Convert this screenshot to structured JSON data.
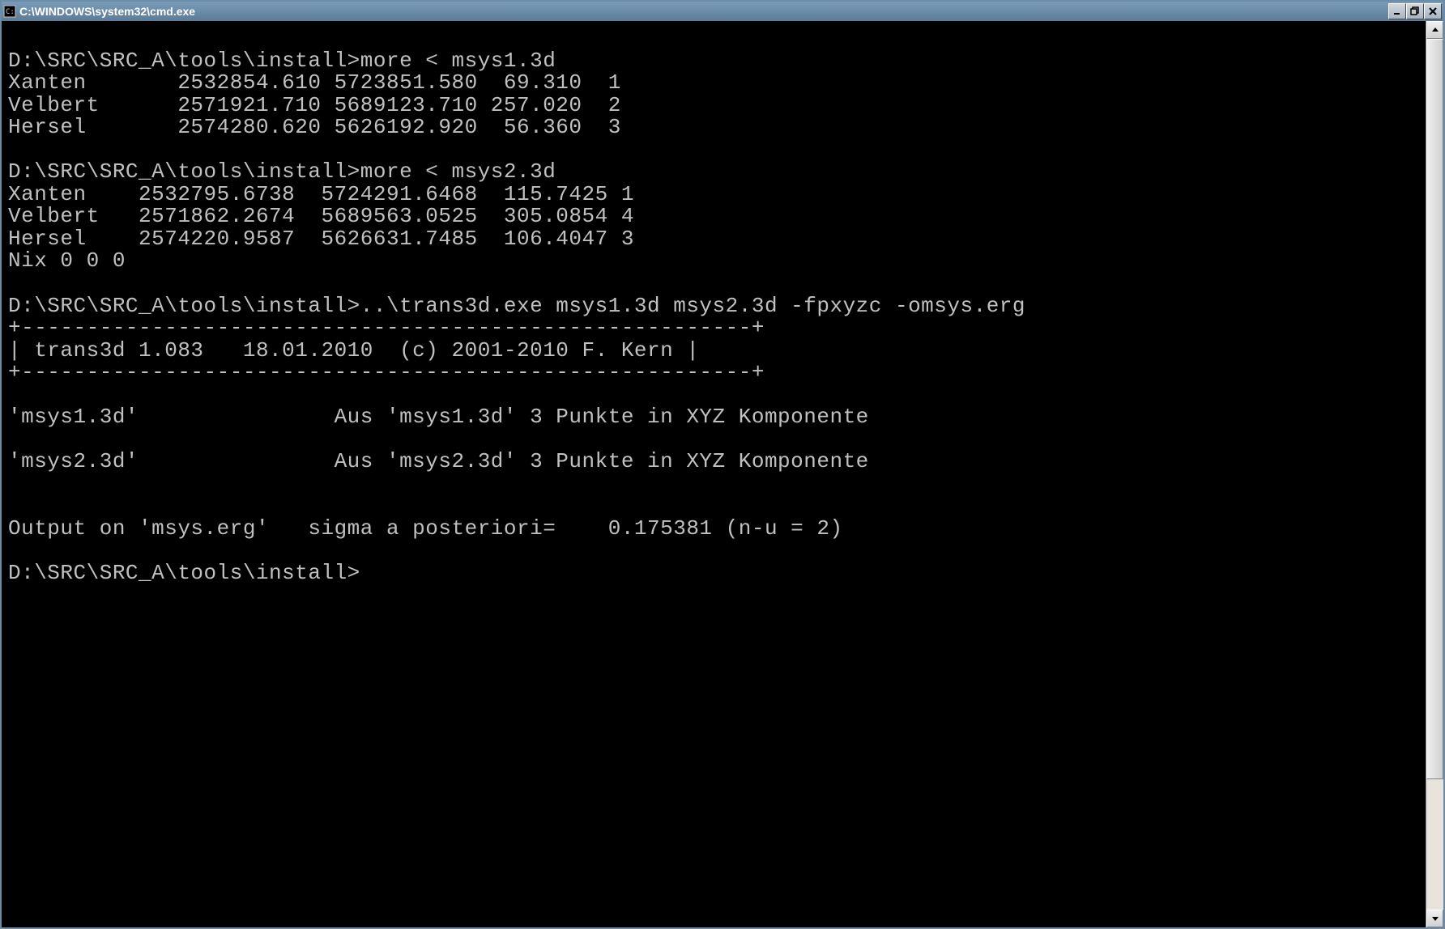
{
  "window": {
    "title": "C:\\WINDOWS\\system32\\cmd.exe"
  },
  "terminal": {
    "lines": [
      "",
      "D:\\SRC\\SRC_A\\tools\\install>more < msys1.3d",
      "Xanten       2532854.610 5723851.580  69.310  1",
      "Velbert      2571921.710 5689123.710 257.020  2",
      "Hersel       2574280.620 5626192.920  56.360  3",
      "",
      "D:\\SRC\\SRC_A\\tools\\install>more < msys2.3d",
      "Xanten    2532795.6738  5724291.6468  115.7425 1",
      "Velbert   2571862.2674  5689563.0525  305.0854 4",
      "Hersel    2574220.9587  5626631.7485  106.4047 3",
      "Nix 0 0 0",
      "",
      "D:\\SRC\\SRC_A\\tools\\install>..\\trans3d.exe msys1.3d msys2.3d -fpxyzc -omsys.erg",
      "+--------------------------------------------------------+",
      "| trans3d 1.083   18.01.2010  (c) 2001-2010 F. Kern |",
      "+--------------------------------------------------------+",
      "",
      "'msys1.3d'               Aus 'msys1.3d' 3 Punkte in XYZ Komponente",
      "",
      "'msys2.3d'               Aus 'msys2.3d' 3 Punkte in XYZ Komponente",
      "",
      "",
      "Output on 'msys.erg'   sigma a posteriori=    0.175381 (n-u = 2)",
      "",
      "D:\\SRC\\SRC_A\\tools\\install>"
    ]
  }
}
